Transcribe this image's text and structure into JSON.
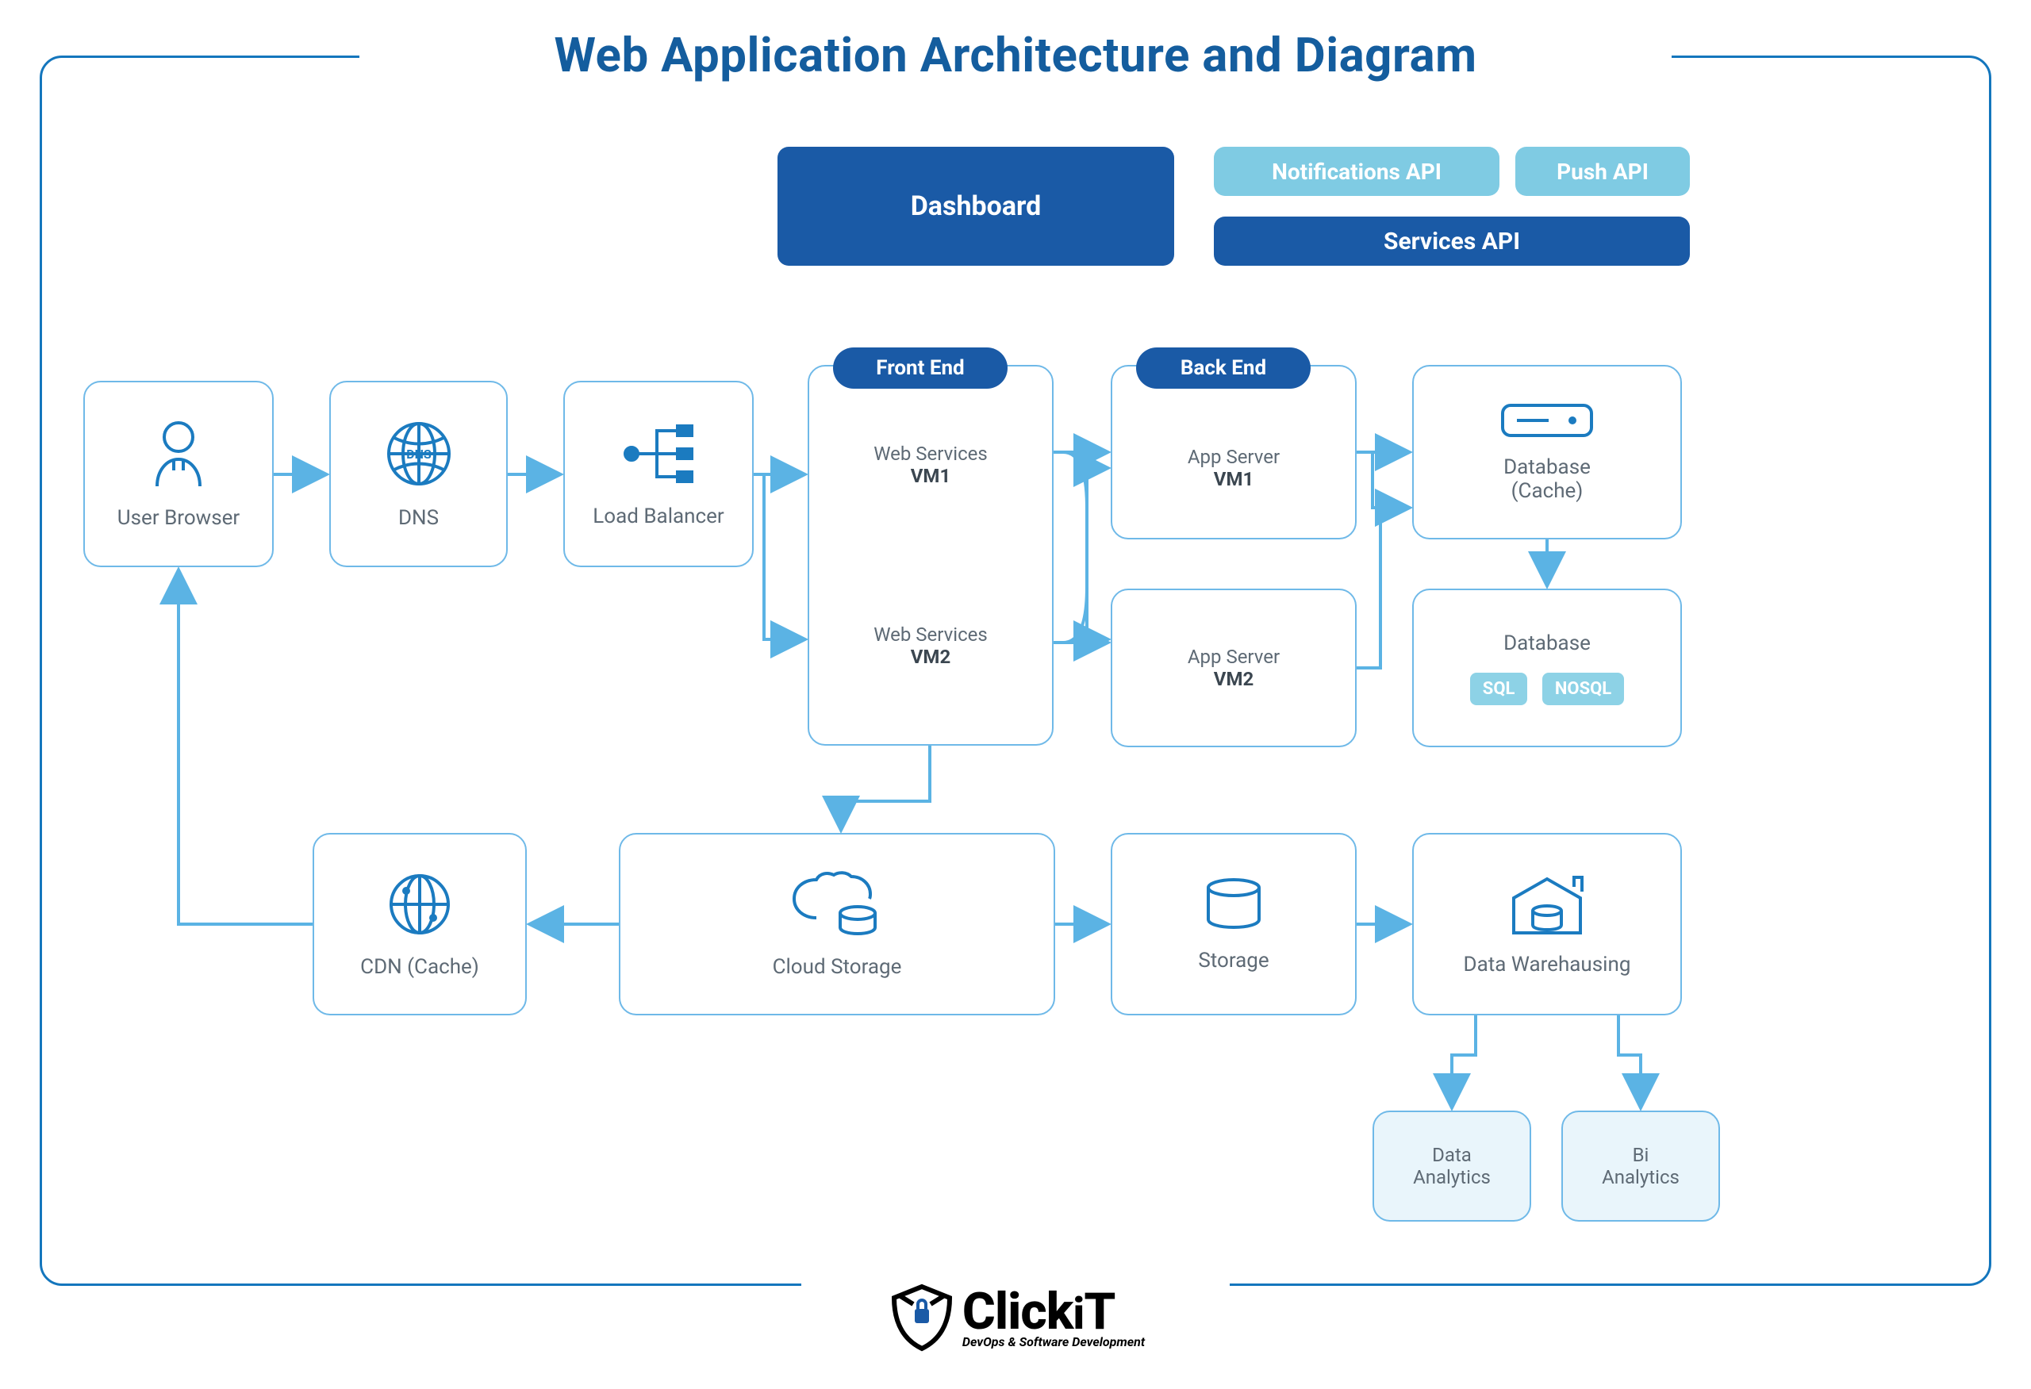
{
  "title": "Web Application Architecture and Diagram",
  "nodes": {
    "userBrowser": "User Browser",
    "dns": "DNS",
    "loadBalancer": "Load Balancer",
    "webServices1_a": "Web Services",
    "webServices1_b": "VM1",
    "webServices2_a": "Web Services",
    "webServices2_b": "VM2",
    "appServer1_a": "App Server",
    "appServer1_b": "VM1",
    "appServer2_a": "App Server",
    "appServer2_b": "VM2",
    "databaseCache_a": "Database",
    "databaseCache_b": "(Cache)",
    "database": "Database",
    "sql": "SQL",
    "nosql": "NOSQL",
    "cdn": "CDN (Cache)",
    "cloudStorage": "Cloud Storage",
    "storage": "Storage",
    "dataWarehousing": "Data Warehausing",
    "dataAnalytics_a": "Data",
    "dataAnalytics_b": "Analytics",
    "biAnalytics_a": "Bi",
    "biAnalytics_b": "Analytics"
  },
  "pills": {
    "frontEnd": "Front End",
    "backEnd": "Back End"
  },
  "buttons": {
    "dashboard": "Dashboard",
    "notificationsApi": "Notifications API",
    "pushApi": "Push API",
    "servicesApi": "Services API"
  },
  "logo": {
    "name": "ClickiT",
    "tagline": "DevOps & Software Development"
  }
}
